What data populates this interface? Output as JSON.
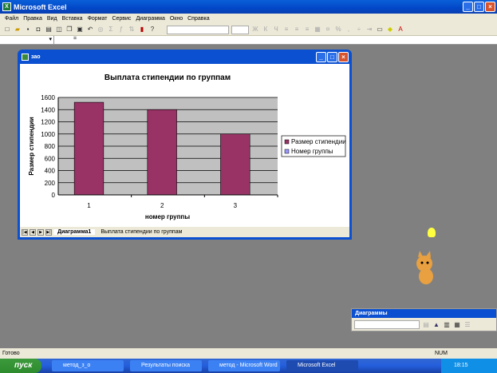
{
  "app": {
    "title": "Microsoft Excel"
  },
  "menu": [
    "Файл",
    "Правка",
    "Вид",
    "Вставка",
    "Формат",
    "Сервис",
    "Диаграмма",
    "Окно",
    "Справка"
  ],
  "formula": {
    "eq": "="
  },
  "chart_window": {
    "title": "зао",
    "tabs": [
      "Диаграмма1",
      "Выплата стипендии по группам"
    ],
    "active_tab": 0
  },
  "chart_data": {
    "type": "bar",
    "title": "Выплата стипендии по группам",
    "xlabel": "номер группы",
    "ylabel": "Размер стипендии",
    "categories": [
      "1",
      "2",
      "3"
    ],
    "series": [
      {
        "name": "Размер стипендии",
        "values": [
          1520,
          1400,
          1000
        ],
        "color": "#993366"
      },
      {
        "name": "Номер группы",
        "values": [],
        "color": "#9999ff"
      }
    ],
    "ylim": [
      0,
      1600
    ],
    "yticks": [
      "0",
      "200",
      "400",
      "600",
      "800",
      "1000",
      "1200",
      "1400",
      "1600"
    ],
    "grid": true,
    "plot_background": "#c0c0c0",
    "legend": "right"
  },
  "status": {
    "text": "Готово",
    "num": "NUM"
  },
  "diagram_toolbar": {
    "title": "Диаграммы"
  },
  "taskbar": {
    "start": "пуск",
    "tasks": [
      "метод_з_о",
      "Результаты поиска",
      "метод - Microsoft Word",
      "Microsoft Excel"
    ],
    "lang": "RU",
    "clock": "18:15"
  }
}
